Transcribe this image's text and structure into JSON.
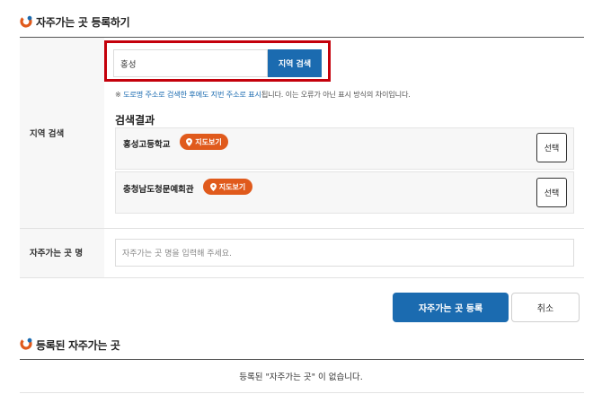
{
  "register_section": {
    "title": "자주가는 곳 등록하기"
  },
  "region_search": {
    "label": "지역 검색",
    "input_value": "홍성",
    "search_button": "지역 검색",
    "notice": {
      "prefix": "※ ",
      "highlight": "도로명 주소로 검색한 후에도 지번 주소로 표시",
      "suffix": "됩니다. 이는 오류가 아닌 표시 방식의 차이입니다."
    },
    "results_title": "검색결과",
    "results": [
      {
        "name": "홍성고등학교",
        "map_label": "지도보기",
        "select_label": "선택"
      },
      {
        "name": "충청남도청문예회관",
        "map_label": "지도보기",
        "select_label": "선택"
      }
    ]
  },
  "place_name": {
    "label": "자주가는 곳 명",
    "placeholder": "자주가는 곳 명을 입력해 주세요."
  },
  "actions": {
    "register": "자주가는 곳 등록",
    "cancel": "취소"
  },
  "registered_section": {
    "title": "등록된 자주가는 곳",
    "empty_message": "등록된 \"자주가는 곳\" 이 없습니다."
  },
  "colors": {
    "accent_blue": "#1b6bb0",
    "pill_orange": "#e05a1c",
    "highlight_red": "#c4000b"
  }
}
